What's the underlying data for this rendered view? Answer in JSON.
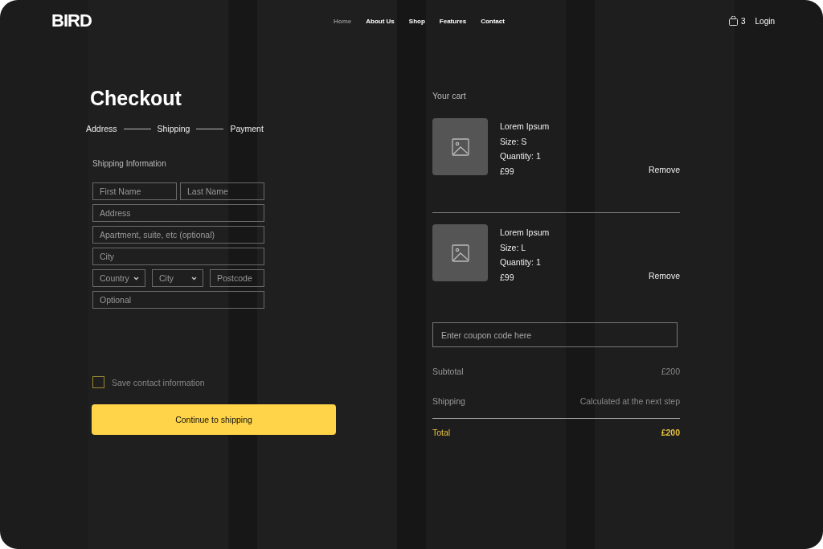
{
  "header": {
    "logo": "BIRD",
    "nav": [
      {
        "label": "Home",
        "selected": true
      },
      {
        "label": "About Us",
        "selected": false
      },
      {
        "label": "Shop",
        "selected": false
      },
      {
        "label": "Features",
        "selected": false
      },
      {
        "label": "Contact",
        "selected": false
      }
    ],
    "cart_count": "3",
    "login": "Login"
  },
  "checkout": {
    "title": "Checkout",
    "steps": [
      "Address",
      "Shipping",
      "Payment"
    ],
    "section": "Shipping Information",
    "rows": [
      [
        {
          "kind": "text",
          "placeholder": "First Name"
        },
        {
          "kind": "text",
          "placeholder": "Last Name"
        }
      ],
      [
        {
          "kind": "text",
          "placeholder": "Address"
        }
      ],
      [
        {
          "kind": "text",
          "placeholder": "Apartment, suite, etc (optional)"
        }
      ],
      [
        {
          "kind": "text",
          "placeholder": "City"
        }
      ],
      [
        {
          "kind": "select",
          "placeholder": "Country"
        },
        {
          "kind": "select",
          "placeholder": "City"
        },
        {
          "kind": "text",
          "placeholder": "Postcode"
        }
      ],
      [
        {
          "kind": "text",
          "placeholder": "Optional"
        }
      ]
    ],
    "save": {
      "label": "Save contact information",
      "checked": false
    },
    "button": "Continue to shipping"
  },
  "cart": {
    "title": "Your cart",
    "items": [
      {
        "name": "Lorem Ipsum",
        "size": "Size: S",
        "quantity": "Quantity: 1",
        "price": "£99",
        "remove": "Remove"
      },
      {
        "name": "Lorem Ipsum",
        "size": "Size: L",
        "quantity": "Quantity: 1",
        "price": "£99",
        "remove": "Remove"
      }
    ],
    "coupon": {
      "placeholder": "Enter coupon code here"
    },
    "summary": [
      {
        "label": "Subtotal",
        "value": "£200",
        "kind": "plain"
      },
      {
        "label": "Shipping",
        "value": "Calculated at the next step",
        "kind": "plain"
      },
      {
        "label": "Total",
        "value": "£200",
        "kind": "total"
      }
    ]
  }
}
